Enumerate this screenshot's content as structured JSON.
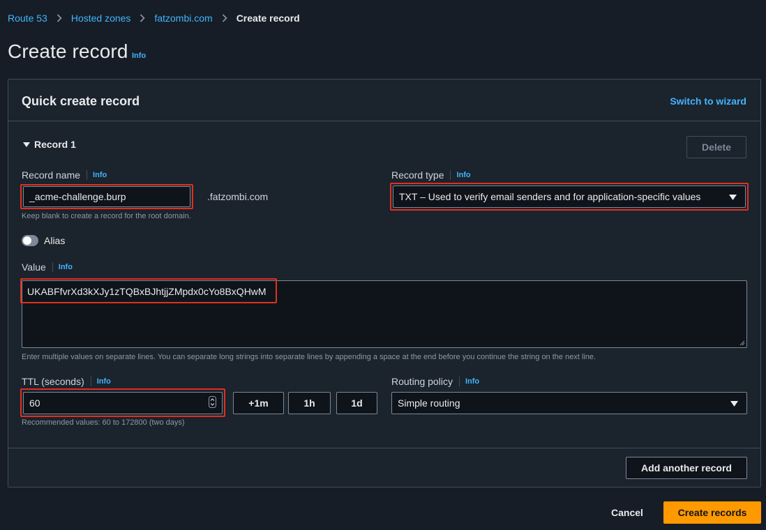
{
  "breadcrumb": {
    "items": [
      "Route 53",
      "Hosted zones",
      "fatzombi.com"
    ],
    "current": "Create record"
  },
  "page": {
    "title": "Create record",
    "info": "Info"
  },
  "panel": {
    "title": "Quick create record",
    "switch_link": "Switch to wizard"
  },
  "record": {
    "section_label": "Record 1",
    "delete_label": "Delete",
    "name": {
      "label": "Record name",
      "info": "Info",
      "value": "_acme-challenge.burp",
      "suffix": ".fatzombi.com",
      "hint": "Keep blank to create a record for the root domain."
    },
    "type": {
      "label": "Record type",
      "info": "Info",
      "value": "TXT – Used to verify email senders and for application-specific values"
    },
    "alias": {
      "label": "Alias",
      "enabled": false
    },
    "value": {
      "label": "Value",
      "info": "Info",
      "text": "UKABFfvrXd3kXJy1zTQBxBJhtjjZMpdx0cYo8BxQHwM",
      "hint": "Enter multiple values on separate lines. You can separate long strings into separate lines by appending a space at the end before you continue the string on the next line."
    },
    "ttl": {
      "label": "TTL (seconds)",
      "info": "Info",
      "value": "60",
      "hint": "Recommended values: 60 to 172800 (two days)",
      "presets": [
        "+1m",
        "1h",
        "1d"
      ]
    },
    "routing": {
      "label": "Routing policy",
      "info": "Info",
      "value": "Simple routing"
    }
  },
  "actions": {
    "add_another": "Add another record",
    "cancel": "Cancel",
    "create": "Create records"
  },
  "colors": {
    "background": "#161d26",
    "panel": "#1b232d",
    "link": "#42b4ff",
    "primary_button": "#ff9900",
    "highlight_border": "#e0301e"
  }
}
